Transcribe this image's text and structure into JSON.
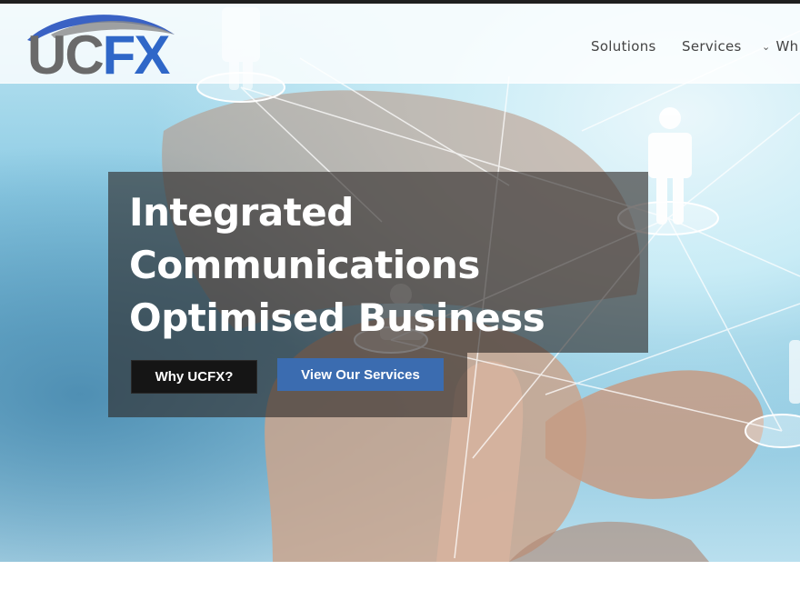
{
  "brand": {
    "logo_part1": "UC",
    "logo_part2": "FX",
    "logo_colors": {
      "grey": "#6a6a6a",
      "blue": "#2f67c8"
    }
  },
  "nav": {
    "items": [
      {
        "label": "Solutions"
      },
      {
        "label": "Services"
      },
      {
        "label": "Wh",
        "icon": "chevron-down-icon"
      }
    ]
  },
  "hero": {
    "title_lines": [
      "Integrated",
      "Communications",
      "Optimised Business"
    ],
    "primary_button": "Why UCFX?",
    "secondary_button": "View Our Services",
    "colors": {
      "primary_button": "#151515",
      "secondary_button": "#3b6cb0",
      "overlay": "#2d2826"
    }
  }
}
